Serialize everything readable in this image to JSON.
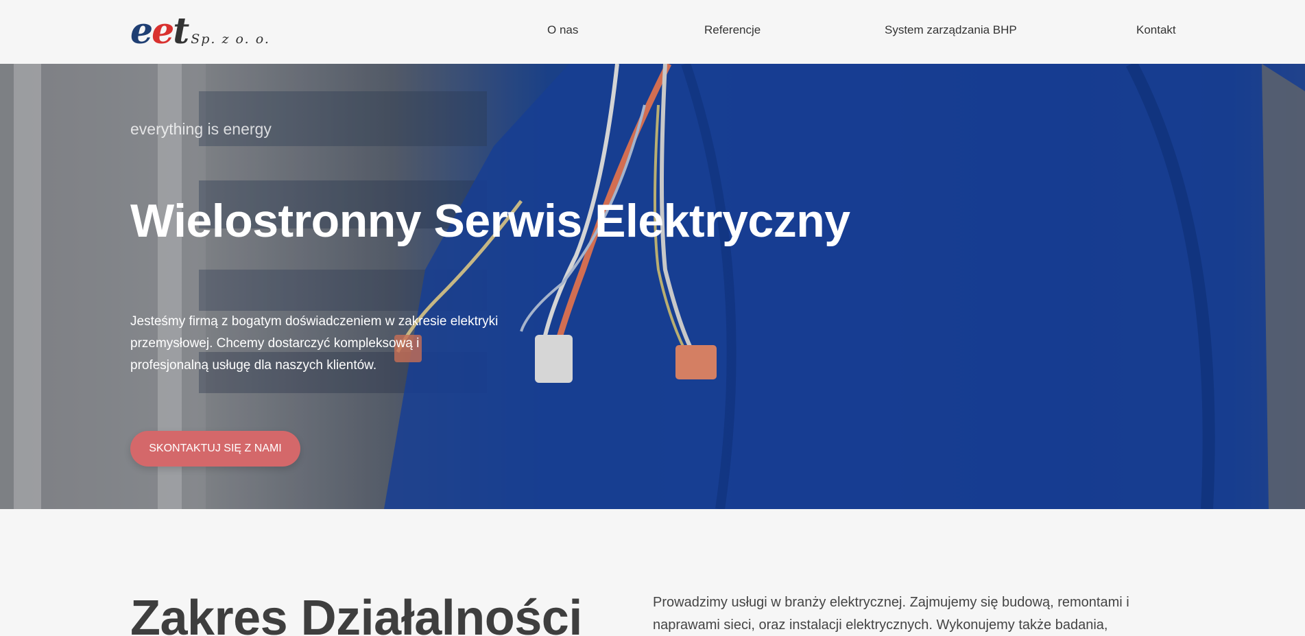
{
  "header": {
    "logo": {
      "main": "eet",
      "suffix": "Sp. z o. o."
    },
    "nav": [
      {
        "label": "O nas"
      },
      {
        "label": "Referencje"
      },
      {
        "label": "System zarządzania BHP"
      },
      {
        "label": "Kontakt"
      }
    ]
  },
  "hero": {
    "tagline": "everything is energy",
    "title": "Wielostronny Serwis Elektryczny",
    "description": "Jesteśmy firmą z bogatym doświadczeniem w zakresie elektryki przemysłowej. Chcemy dostarczyć kompleksową i profesjonalną usługę dla naszych klientów.",
    "cta_label": "SKONTAKTUJ SIĘ Z NAMI"
  },
  "section": {
    "title": "Zakres Działalności",
    "text": "Prowadzimy usługi w branży elektrycznej. Zajmujemy się budową, remontami i naprawami sieci, oraz instalacji elektrycznych. Wykonujemy także badania,"
  },
  "colors": {
    "accent": "#d4686a",
    "logo_blue": "#1f3f73",
    "logo_red": "#d9312f",
    "hero_blue": "#17409a"
  }
}
